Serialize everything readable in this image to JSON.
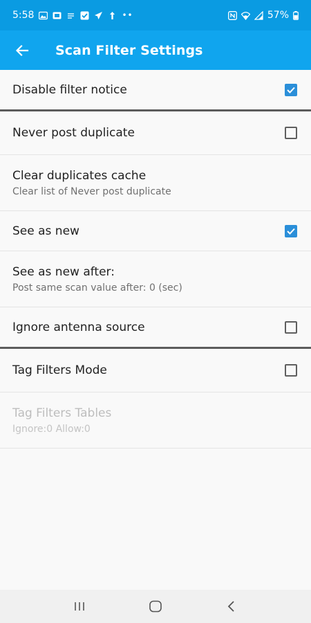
{
  "status_bar": {
    "time": "5:58",
    "battery": "57%",
    "icons": [
      "gallery-icon",
      "app-notification-icon",
      "media-icon",
      "checklist-icon",
      "send-icon",
      "upload-icon",
      "more-dots-icon",
      "nfc-icon",
      "wifi-icon",
      "signal-icon",
      "battery-icon"
    ]
  },
  "app_bar": {
    "title": "Scan Filter Settings",
    "back_icon": "arrow-back-icon"
  },
  "settings": [
    {
      "title": "Disable filter notice",
      "summary": "",
      "checked": true,
      "has_checkbox": true,
      "enabled": true
    },
    {
      "title": "Never post duplicate",
      "summary": "",
      "checked": false,
      "has_checkbox": true,
      "enabled": true
    },
    {
      "title": "Clear duplicates cache",
      "summary": "Clear list of Never post duplicate",
      "has_checkbox": false,
      "enabled": true
    },
    {
      "title": "See as new",
      "summary": "",
      "checked": true,
      "has_checkbox": true,
      "enabled": true
    },
    {
      "title": "See as new after:",
      "summary": "Post same scan value after: 0 (sec)",
      "has_checkbox": false,
      "enabled": true
    },
    {
      "title": "Ignore antenna source",
      "summary": "",
      "checked": false,
      "has_checkbox": true,
      "enabled": true
    },
    {
      "title": "Tag Filters Mode",
      "summary": "",
      "checked": false,
      "has_checkbox": true,
      "enabled": true
    },
    {
      "title": "Tag Filters Tables",
      "summary": "Ignore:0 Allow:0",
      "has_checkbox": false,
      "enabled": false
    }
  ],
  "nav_bar": {
    "icons": [
      "recent-apps-icon",
      "home-icon",
      "back-icon"
    ]
  },
  "colors": {
    "status_bar": "#0a9be2",
    "app_bar": "#10a5ee",
    "checkbox_checked": "#2b8fd9"
  }
}
